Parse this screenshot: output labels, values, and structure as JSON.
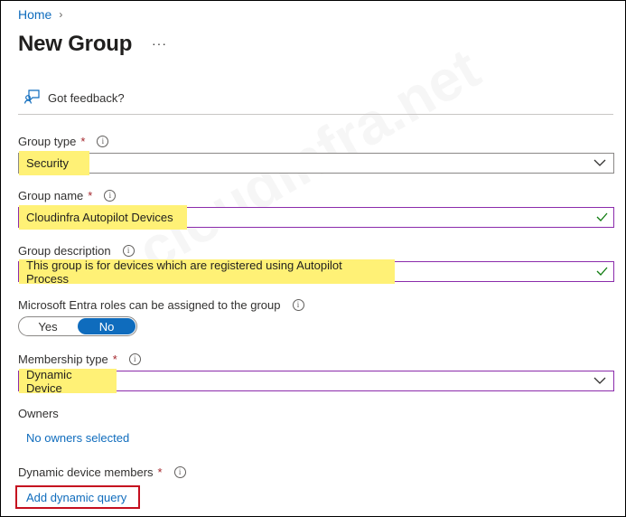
{
  "breadcrumb": {
    "home": "Home",
    "separator": "›"
  },
  "page": {
    "title": "New Group",
    "more": "···"
  },
  "toolbar": {
    "feedback": "Got feedback?"
  },
  "fields": {
    "group_type": {
      "label": "Group type",
      "required": "*",
      "value": "Security"
    },
    "group_name": {
      "label": "Group name",
      "required": "*",
      "value": "Cloudinfra Autopilot Devices"
    },
    "group_description": {
      "label": "Group description",
      "value": "This group is for devices which are registered using Autopilot Process"
    },
    "entra_roles": {
      "label": "Microsoft Entra roles can be assigned to the group",
      "yes": "Yes",
      "no": "No",
      "selected": "No"
    },
    "membership_type": {
      "label": "Membership type",
      "required": "*",
      "value": "Dynamic Device"
    },
    "owners": {
      "label": "Owners",
      "link": "No owners selected"
    },
    "dynamic_members": {
      "label": "Dynamic device members",
      "required": "*",
      "link": "Add dynamic query"
    }
  },
  "watermark": "cloudinfra.net",
  "colors": {
    "accent": "#0f6cbd",
    "highlight": "#fff176",
    "required": "#a4262c",
    "annotation": "#c50f1f",
    "valid": "#107c10"
  }
}
